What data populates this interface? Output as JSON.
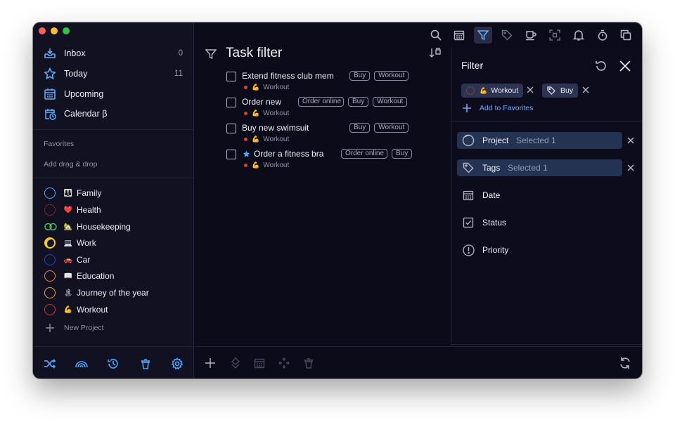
{
  "colors": {
    "accent": "#5fb0ff",
    "window_bg": "#0b0b1a",
    "sidebar_bg": "#111122",
    "selected_row": "#243352",
    "chip_bg": "#2c3452"
  },
  "sidebar": {
    "nav": [
      {
        "label": "Inbox",
        "count": "0",
        "icon": "inbox-icon"
      },
      {
        "label": "Today",
        "count": "11",
        "icon": "star-icon"
      },
      {
        "label": "Upcoming",
        "count": "",
        "icon": "calendar-grid-icon"
      },
      {
        "label": "Calendar β",
        "count": "",
        "icon": "calendar-clock-icon"
      }
    ],
    "favorites_heading": "Favorites",
    "favorites_hint": "Add drag & drop",
    "projects": [
      {
        "label": "Family",
        "emoji": "👪",
        "color": "#4aa8ff"
      },
      {
        "label": "Health",
        "emoji": "❤️",
        "color": "#e63b2e"
      },
      {
        "label": "Housekeeping",
        "emoji": "🏡",
        "color": "#4cc34c"
      },
      {
        "label": "Work",
        "emoji": "💻",
        "color": "#f5d020"
      },
      {
        "label": "Car",
        "emoji": "🚗",
        "color": "#2a3fd6"
      },
      {
        "label": "Education",
        "emoji": "📖",
        "color": "#f08a2a"
      },
      {
        "label": "Journey of the year",
        "emoji": "🏝",
        "color": "#f0a030"
      },
      {
        "label": "Workout",
        "emoji": "💪",
        "color": "#d8302a"
      }
    ],
    "new_project": "New Project",
    "bottom_icons": [
      "shuffle-icon",
      "rainbow-icon",
      "history-icon",
      "trash-icon",
      "settings-icon"
    ]
  },
  "toolbar": {
    "icons": [
      "search-icon",
      "calendar-icon",
      "filter-icon",
      "tag-icon",
      "coffee-icon",
      "focus-icon",
      "bell-icon",
      "timer-icon",
      "copy-icon"
    ]
  },
  "main": {
    "title": "Task filter",
    "tasks": [
      {
        "name": "Extend fitness club mem",
        "star": false,
        "tags": [
          "Buy",
          "Workout"
        ],
        "project_emoji": "💪",
        "project": "Workout"
      },
      {
        "name": "Order new",
        "star": false,
        "tags": [
          "Order online",
          "Buy",
          "Workout"
        ],
        "project_emoji": "💪",
        "project": "Workout"
      },
      {
        "name": "Buy new swimsuit",
        "star": false,
        "tags": [
          "Buy",
          "Workout"
        ],
        "project_emoji": "💪",
        "project": "Workout"
      },
      {
        "name": "Order a fitness bra",
        "star": true,
        "tags": [
          "Order online",
          "Buy"
        ],
        "project_emoji": "💪",
        "project": "Workout"
      }
    ],
    "bottom_icons": [
      "add-icon",
      "priority-icon",
      "date-icon",
      "move-icon",
      "delete-icon"
    ]
  },
  "filter": {
    "title": "Filter",
    "chips": [
      {
        "emoji": "💪",
        "label": "Workout"
      },
      {
        "label": "Buy"
      }
    ],
    "add_favorites": "Add to Favorites",
    "rows": [
      {
        "label": "Project",
        "status": "Selected 1",
        "selected": true
      },
      {
        "label": "Tags",
        "status": "Selected 1",
        "selected": true
      },
      {
        "label": "Date",
        "status": "",
        "selected": false
      },
      {
        "label": "Status",
        "status": "",
        "selected": false
      },
      {
        "label": "Priority",
        "status": "",
        "selected": false
      }
    ]
  }
}
